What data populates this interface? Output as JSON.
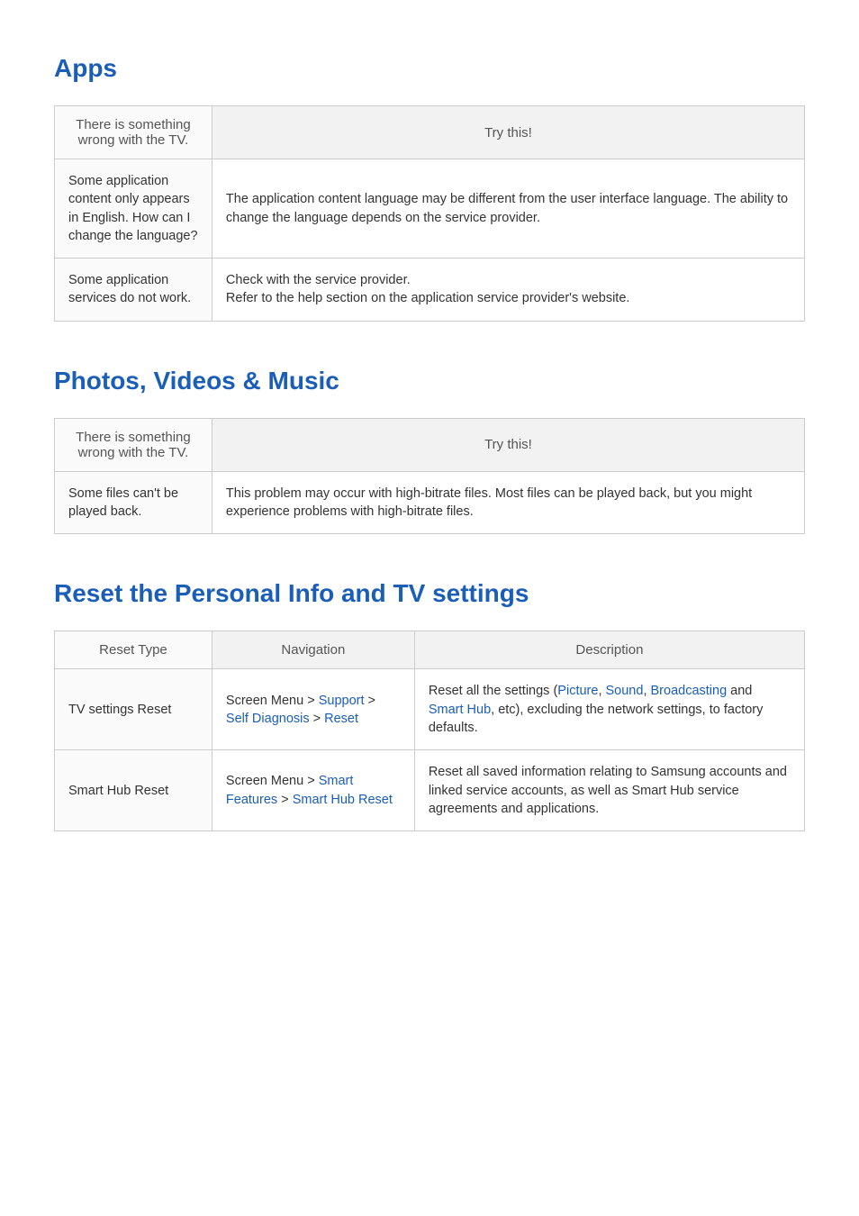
{
  "sections": {
    "apps": {
      "title": "Apps",
      "headers": {
        "problem": "There is something wrong with the TV.",
        "solution": "Try this!"
      },
      "rows": [
        {
          "problem": "Some application content only appears in English. How can I change the language?",
          "solution": "The application content language may be different from the user interface language. The ability to change the language depends on the service provider."
        },
        {
          "problem": "Some application services do not work.",
          "solution": "Check with the service provider.\nRefer to the help section on the application service provider's website."
        }
      ]
    },
    "media": {
      "title": "Photos, Videos & Music",
      "headers": {
        "problem": "There is something wrong with the TV.",
        "solution": "Try this!"
      },
      "rows": [
        {
          "problem": "Some files can't be played back.",
          "solution": "This problem may occur with high-bitrate files. Most files can be played back, but you might experience problems with high-bitrate files."
        }
      ]
    },
    "reset": {
      "title": "Reset the Personal Info and TV settings",
      "headers": {
        "type": "Reset Type",
        "navigation": "Navigation",
        "description": "Description"
      },
      "rows": [
        {
          "type": "TV settings Reset",
          "nav_prefix1": "Screen Menu",
          "nav_sep1": " > ",
          "nav_link1": "Support",
          "nav_sep2": " > ",
          "nav_link2": "Self Diagnosis",
          "nav_sep3": " > ",
          "nav_link3": "Reset",
          "desc_prefix": "Reset all the settings (",
          "desc_link1": "Picture",
          "desc_comma1": ", ",
          "desc_link2": "Sound",
          "desc_comma2": ", ",
          "desc_link3": "Broadcasting",
          "desc_and": " and ",
          "desc_link4": "Smart Hub",
          "desc_suffix": ", etc), excluding the network settings, to factory defaults."
        },
        {
          "type": "Smart Hub Reset",
          "nav_prefix1": "Screen Menu",
          "nav_sep1": " > ",
          "nav_link1": "Smart Features",
          "nav_sep2": " > ",
          "nav_link2": "Smart Hub Reset",
          "desc_full": "Reset all saved information relating to Samsung accounts and linked service accounts, as well as Smart Hub service agreements and applications."
        }
      ]
    }
  }
}
